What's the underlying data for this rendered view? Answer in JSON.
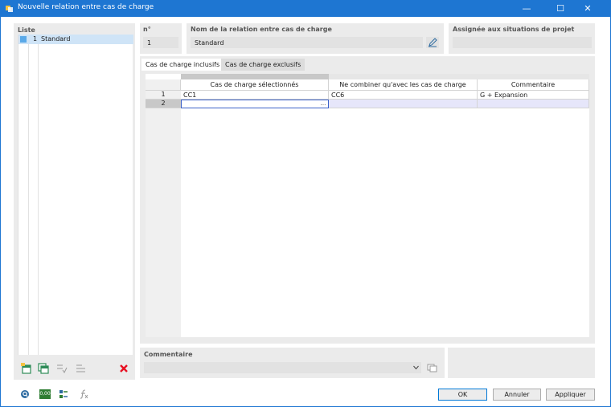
{
  "window": {
    "title": "Nouvelle relation entre cas de charge"
  },
  "list": {
    "title": "Liste",
    "items": [
      {
        "number": "1",
        "label": "Standard"
      }
    ]
  },
  "header": {
    "number_label": "n°",
    "number_value": "1",
    "name_label": "Nom de la relation entre cas de charge",
    "name_value": "Standard",
    "assigned_label": "Assignée aux situations de projet",
    "assigned_value": ""
  },
  "tabs": [
    {
      "label": "Cas de charge inclusifs",
      "active": true
    },
    {
      "label": "Cas de charge exclusifs",
      "active": false
    }
  ],
  "table": {
    "columns": [
      "Cas de charge sélectionnés",
      "Ne combiner qu'avec les cas de charge",
      "Commentaire"
    ],
    "rows": [
      {
        "num": "1",
        "selected": "CC1",
        "combine_only": "CC6",
        "comment": "G + Expansion"
      },
      {
        "num": "2",
        "selected": "",
        "combine_only": "",
        "comment": ""
      }
    ],
    "ellipsis": "..."
  },
  "comment_section": {
    "title": "Commentaire",
    "value": ""
  },
  "buttons": {
    "ok": "OK",
    "cancel": "Annuler",
    "apply": "Appliquer"
  },
  "bottom_icons": {
    "zero_label": "0,00"
  },
  "colors": {
    "titlebar": "#1e76d2",
    "selection": "#cfe4f7",
    "delete_red": "#e81123",
    "active_row": "#e6e6fa"
  }
}
